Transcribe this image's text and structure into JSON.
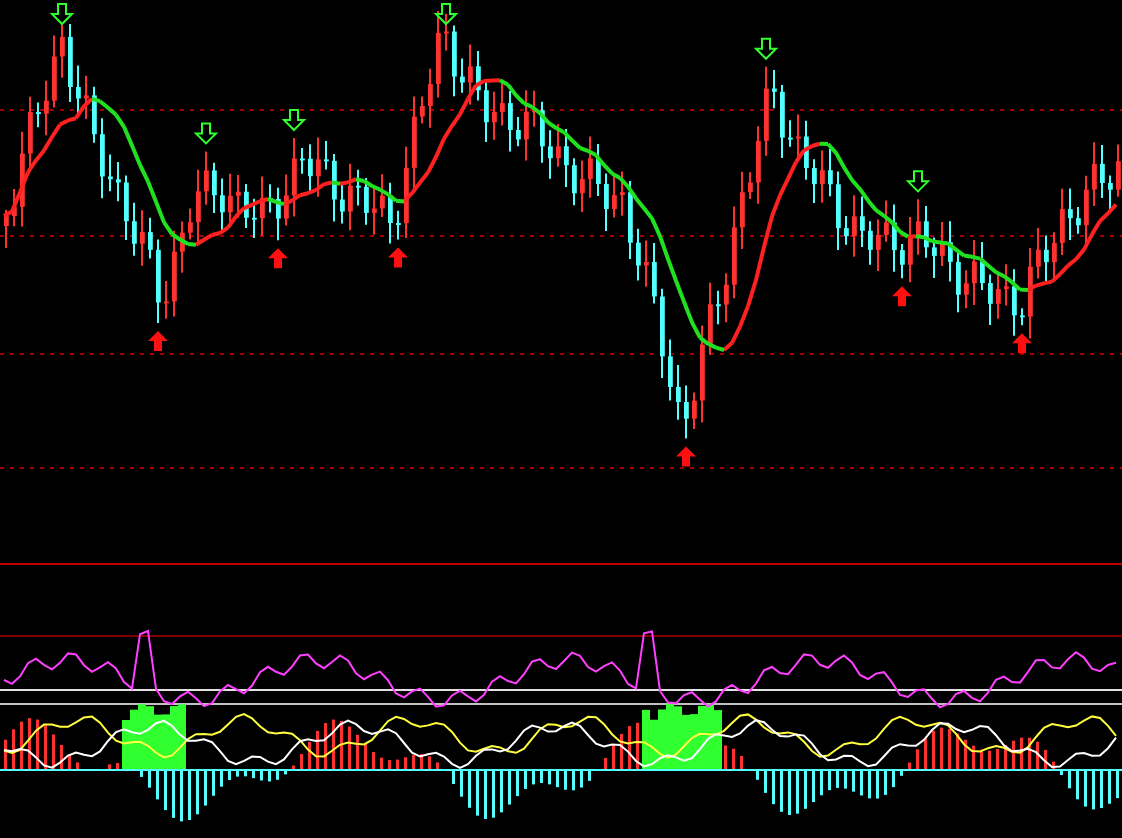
{
  "panels": [
    {
      "kind": "price"
    },
    {
      "kind": "indicator"
    }
  ]
}
